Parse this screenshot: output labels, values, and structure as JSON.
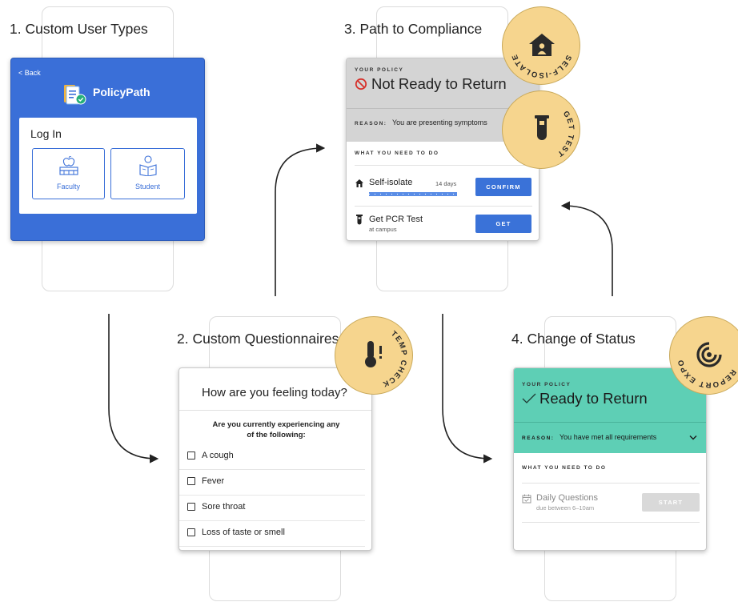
{
  "steps": {
    "s1": "1. Custom User Types",
    "s2": "2. Custom Questionnaires",
    "s3": "3. Path to Compliance",
    "s4": "4. Change of Status"
  },
  "login": {
    "back": "< Back",
    "brand": "PolicyPath",
    "title": "Log In",
    "faculty": "Faculty",
    "student": "Student",
    "bg_color": "#3a6fd8"
  },
  "questionnaire": {
    "title": "How are you feeling today?",
    "prompt_line1": "Are you currently experiencing any",
    "prompt_line2": "of the following:",
    "options": [
      "A cough",
      "Fever",
      "Sore throat",
      "Loss of taste or smell"
    ]
  },
  "compliance": {
    "policy_label": "YOUR POLICY",
    "status": "Not Ready to Return",
    "reason_label": "REASON:",
    "reason": "You are presenting symptoms",
    "todo_label": "WHAT YOU NEED TO DO",
    "task1": "Self-isolate",
    "task1_days": "14 days",
    "task1_btn": "CONFIRM",
    "task2": "Get PCR Test",
    "task2_sub": "at campus",
    "task2_btn": "GET",
    "header_color": "#d4d4d4"
  },
  "change": {
    "policy_label": "YOUR POLICY",
    "status": "Ready to Return",
    "reason_label": "REASON:",
    "reason": "You have met all requirements",
    "todo_label": "WHAT YOU NEED TO DO",
    "task": "Daily Questions",
    "task_sub": "due between 6–10am",
    "task_btn": "START",
    "header_color": "#5ecfb5"
  },
  "badges": {
    "self_isolate": "SELF-ISOLATE",
    "get_test": "GET TEST",
    "temp_check": "TEMP CHECK",
    "report_exposure": "REPORT EXPOSURE",
    "color": "#f6d58e"
  }
}
